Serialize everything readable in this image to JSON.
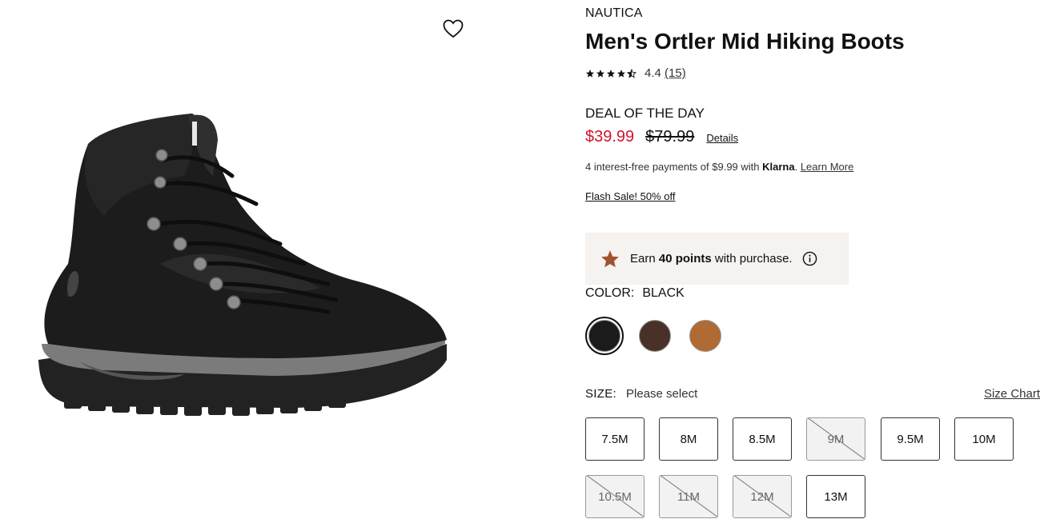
{
  "product": {
    "brand": "NAUTICA",
    "title": "Men's Ortler Mid Hiking Boots",
    "rating": "4.4",
    "review_count": "(15)",
    "stars_filled": 4.4
  },
  "pricing": {
    "deal_label": "DEAL OF THE DAY",
    "sale_price": "$39.99",
    "original_price": "$79.99",
    "details_link": "Details",
    "klarna_prefix": "4 interest-free payments of $9.99 with ",
    "klarna_brand": "Klarna",
    "klarna_suffix": ". ",
    "klarna_learn_more": "Learn More",
    "flash_sale": "Flash Sale! 50% off",
    "sale_color": "#d1132a"
  },
  "rewards": {
    "earn": "Earn ",
    "points": "40 points",
    "suffix": " with purchase.",
    "star_color": "#a0522d"
  },
  "color": {
    "label": "COLOR:",
    "selected": "BLACK",
    "swatches": [
      {
        "name": "Black",
        "hex": "#1b1b1b"
      },
      {
        "name": "Brown",
        "hex": "#4a3128"
      },
      {
        "name": "Tan",
        "hex": "#b06a33"
      }
    ]
  },
  "size": {
    "label": "SIZE:",
    "placeholder": "Please select",
    "chart_link": "Size Chart",
    "options": [
      {
        "label": "7.5M",
        "available": true
      },
      {
        "label": "8M",
        "available": true
      },
      {
        "label": "8.5M",
        "available": true
      },
      {
        "label": "9M",
        "available": false
      },
      {
        "label": "9.5M",
        "available": true
      },
      {
        "label": "10M",
        "available": true
      },
      {
        "label": "10.5M",
        "available": false
      },
      {
        "label": "11M",
        "available": false
      },
      {
        "label": "12M",
        "available": false
      },
      {
        "label": "13M",
        "available": true
      }
    ]
  }
}
